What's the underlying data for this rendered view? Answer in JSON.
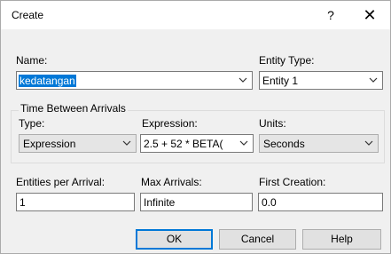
{
  "window": {
    "title": "Create",
    "help_glyph": "?",
    "close_glyph": "✕"
  },
  "name": {
    "label": "Name:",
    "value": "kedatangan"
  },
  "entity_type": {
    "label": "Entity Type:",
    "value": "Entity 1"
  },
  "time_between_arrivals": {
    "group_label": "Time Between Arrivals",
    "type_label": "Type:",
    "type_value": "Expression",
    "expression_label": "Expression:",
    "expression_value": "2.5 + 52 * BETA(",
    "units_label": "Units:",
    "units_value": "Seconds"
  },
  "entities_per_arrival": {
    "label": "Entities per Arrival:",
    "value": "1"
  },
  "max_arrivals": {
    "label": "Max Arrivals:",
    "value": "Infinite"
  },
  "first_creation": {
    "label": "First Creation:",
    "value": "0.0"
  },
  "buttons": {
    "ok": "OK",
    "cancel": "Cancel",
    "help": "Help"
  },
  "icons": {
    "dropdown": "chevron-down-icon",
    "close": "close-icon",
    "help": "help-icon"
  }
}
